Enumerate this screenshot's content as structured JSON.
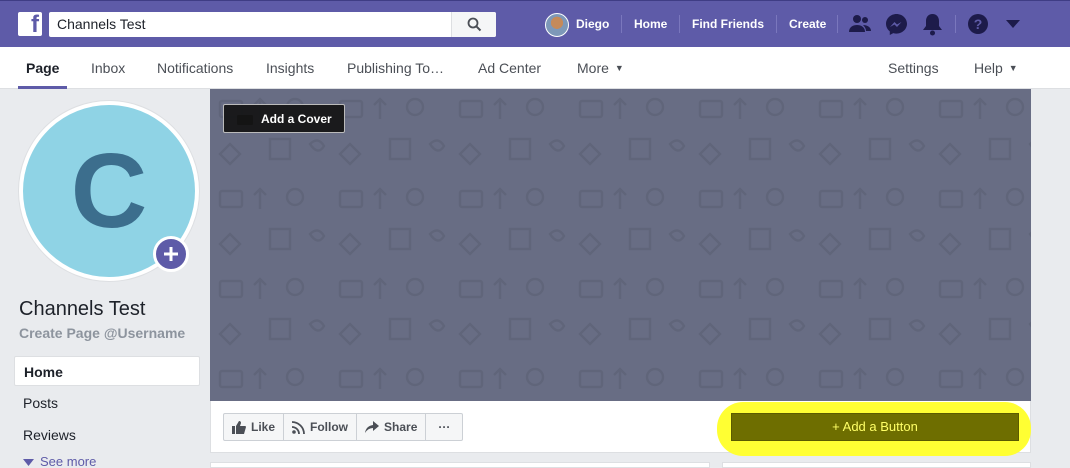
{
  "colors": {
    "brand": "#5e5ba8",
    "cover": "#686d84",
    "highlight": "#ffff33",
    "add_button": "#6e6e00"
  },
  "topbar": {
    "search_value": "Channels Test",
    "user_name": "Diego",
    "links": {
      "home": "Home",
      "find_friends": "Find Friends",
      "create": "Create"
    },
    "icons": [
      "facebook-logo-icon",
      "search-icon",
      "friends-icon",
      "messenger-icon",
      "notifications-bell-icon",
      "help-icon",
      "dropdown-arrow-icon"
    ]
  },
  "tabs": {
    "page": "Page",
    "inbox": "Inbox",
    "notifications": "Notifications",
    "insights": "Insights",
    "publishing": "Publishing To…",
    "ad_center": "Ad Center",
    "more": "More",
    "settings": "Settings",
    "help": "Help"
  },
  "profile": {
    "letter": "C",
    "name": "Channels Test",
    "username_link": "Create Page @Username"
  },
  "sidebar": {
    "items": [
      "Home",
      "Posts",
      "Reviews"
    ],
    "see_more": "See more"
  },
  "cover": {
    "add_cover": "Add a Cover"
  },
  "actions": {
    "like": "Like",
    "follow": "Follow",
    "share": "Share",
    "more": "···",
    "add_button": "+ Add a Button"
  }
}
